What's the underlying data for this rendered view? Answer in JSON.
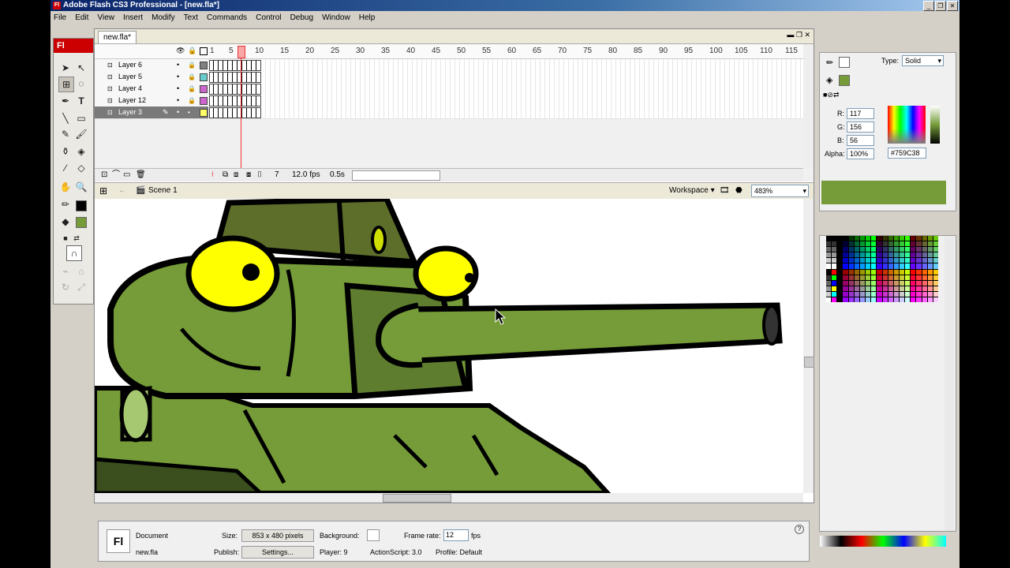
{
  "window": {
    "title": "Adobe Flash CS3 Professional - [new.fla*]",
    "app_icon": "Fl"
  },
  "menu": [
    "File",
    "Edit",
    "View",
    "Insert",
    "Modify",
    "Text",
    "Commands",
    "Control",
    "Debug",
    "Window",
    "Help"
  ],
  "tools": {
    "logo": "Fl"
  },
  "document": {
    "tab": "new.fla*"
  },
  "timeline": {
    "frame_numbers": [
      "1",
      "5",
      "10",
      "15",
      "20",
      "25",
      "30",
      "35",
      "40",
      "45",
      "50",
      "55",
      "60",
      "65",
      "70",
      "75",
      "80",
      "85",
      "90",
      "95",
      "100",
      "105",
      "110",
      "115"
    ],
    "layers": [
      {
        "name": "Layer 6",
        "color": "#808080",
        "selected": false
      },
      {
        "name": "Layer 5",
        "color": "#66cccc",
        "selected": false
      },
      {
        "name": "Layer 4",
        "color": "#cc66cc",
        "selected": false
      },
      {
        "name": "Layer 12",
        "color": "#cc66cc",
        "selected": false
      },
      {
        "name": "Layer 3",
        "color": "#ffff66",
        "selected": true
      }
    ],
    "current_frame": "7",
    "fps": "12.0 fps",
    "time": "0.5s"
  },
  "scene": {
    "name": "Scene 1",
    "workspace": "Workspace",
    "zoom": "483%"
  },
  "color_panel": {
    "type_label": "Type:",
    "type_value": "Solid",
    "r_label": "R:",
    "r": "117",
    "g_label": "G:",
    "g": "156",
    "b_label": "B:",
    "b": "56",
    "alpha_label": "Alpha:",
    "alpha": "100%",
    "hex": "#759C38",
    "fill_color": "#759c38"
  },
  "properties": {
    "kind": "Document",
    "filename": "new.fla",
    "size_label": "Size:",
    "size_value": "853 x 480 pixels",
    "background_label": "Background:",
    "frame_rate_label": "Frame rate:",
    "frame_rate": "12",
    "fps_unit": "fps",
    "publish_label": "Publish:",
    "settings_button": "Settings...",
    "player": "Player: 9",
    "actionscript": "ActionScript: 3.0",
    "profile": "Profile: Default"
  },
  "colors": {
    "tank_green": "#759c38",
    "tank_dark": "#5f7d2f",
    "eye_yellow": "#ffff00",
    "outline": "#000000"
  }
}
